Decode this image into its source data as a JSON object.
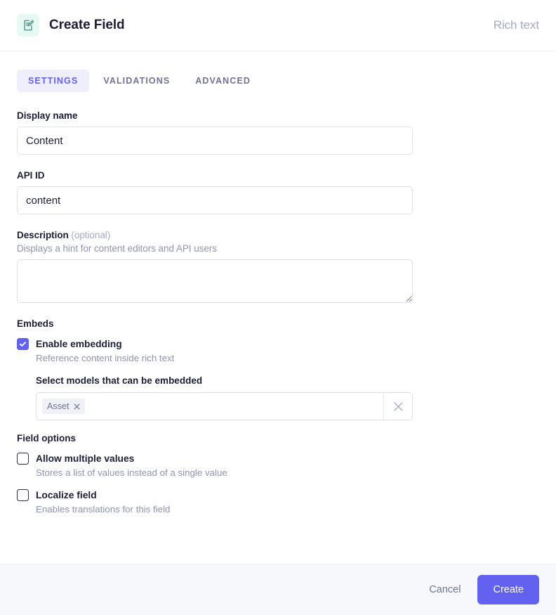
{
  "header": {
    "icon": "rich-text-field-icon",
    "title": "Create Field",
    "field_type": "Rich text",
    "icon_bg": "#e6faf3",
    "icon_color": "#3f8f82"
  },
  "tabs": [
    {
      "label": "SETTINGS",
      "active": true
    },
    {
      "label": "VALIDATIONS",
      "active": false
    },
    {
      "label": "ADVANCED",
      "active": false
    }
  ],
  "form": {
    "display_name": {
      "label": "Display name",
      "value": "Content",
      "placeholder": ""
    },
    "api_id": {
      "label": "API ID",
      "value": "content",
      "placeholder": ""
    },
    "description": {
      "label": "Description",
      "optional_tag": "(optional)",
      "help": "Displays a hint for content editors and API users",
      "value": "",
      "placeholder": ""
    }
  },
  "embeds": {
    "section_title": "Embeds",
    "enable_embedding": {
      "label": "Enable embedding",
      "help": "Reference content inside rich text",
      "checked": true
    },
    "models": {
      "label": "Select models that can be embedded",
      "selected": [
        "Asset"
      ],
      "clear_icon": "close-icon",
      "chip_remove_icon": "close-icon"
    }
  },
  "field_options": {
    "section_title": "Field options",
    "items": [
      {
        "label": "Allow multiple values",
        "help": "Stores a list of values instead of a single value",
        "checked": false
      },
      {
        "label": "Localize field",
        "help": "Enables translations for this field",
        "checked": false
      }
    ]
  },
  "footer": {
    "cancel_label": "Cancel",
    "create_label": "Create"
  },
  "colors": {
    "accent": "#6361ef",
    "accent_soft": "#eeeefc",
    "text": "#1c1e3a",
    "muted": "#8e94b5",
    "border": "#dfe2ee",
    "footer_bg": "#f6f8fb"
  }
}
